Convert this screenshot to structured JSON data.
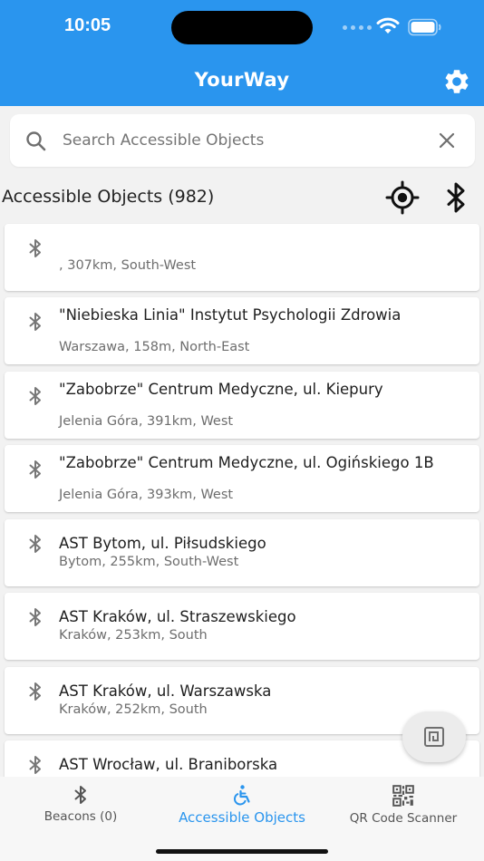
{
  "status_bar": {
    "time": "10:05"
  },
  "header": {
    "title": "YourWay"
  },
  "search": {
    "placeholder": "Search Accessible Objects",
    "value": ""
  },
  "section": {
    "title": "Accessible Objects (982)"
  },
  "items": [
    {
      "title": "",
      "subtitle": ", 307km, South-West"
    },
    {
      "title": "\"Niebieska Linia\" Instytut Psychologii Zdrowia",
      "subtitle": "Warszawa, 158m, North-East"
    },
    {
      "title": "\"Zabobrze\" Centrum Medyczne, ul. Kiepury",
      "subtitle": "Jelenia Góra, 391km, West"
    },
    {
      "title": "\"Zabobrze\" Centrum Medyczne, ul. Ogińskiego 1B",
      "subtitle": "Jelenia Góra, 393km, West"
    },
    {
      "title": "AST Bytom, ul. Piłsudskiego",
      "subtitle": "Bytom, 255km, South-West"
    },
    {
      "title": "AST Kraków, ul. Straszewskiego",
      "subtitle": "Kraków, 253km, South"
    },
    {
      "title": "AST Kraków, ul. Warszawska",
      "subtitle": "Kraków, 252km, South"
    },
    {
      "title": "AST Wrocław, ul. Braniborska",
      "subtitle": ""
    }
  ],
  "tabs": [
    {
      "label": "Beacons (0)",
      "icon": "bluetooth-icon",
      "active": false
    },
    {
      "label": "Accessible Objects",
      "icon": "wheelchair-icon",
      "active": true
    },
    {
      "label": "QR Code Scanner",
      "icon": "qr-code-icon",
      "active": false
    }
  ],
  "colors": {
    "primary": "#2a95ee",
    "background": "#f2f2f2",
    "icon_grey": "#777777"
  }
}
